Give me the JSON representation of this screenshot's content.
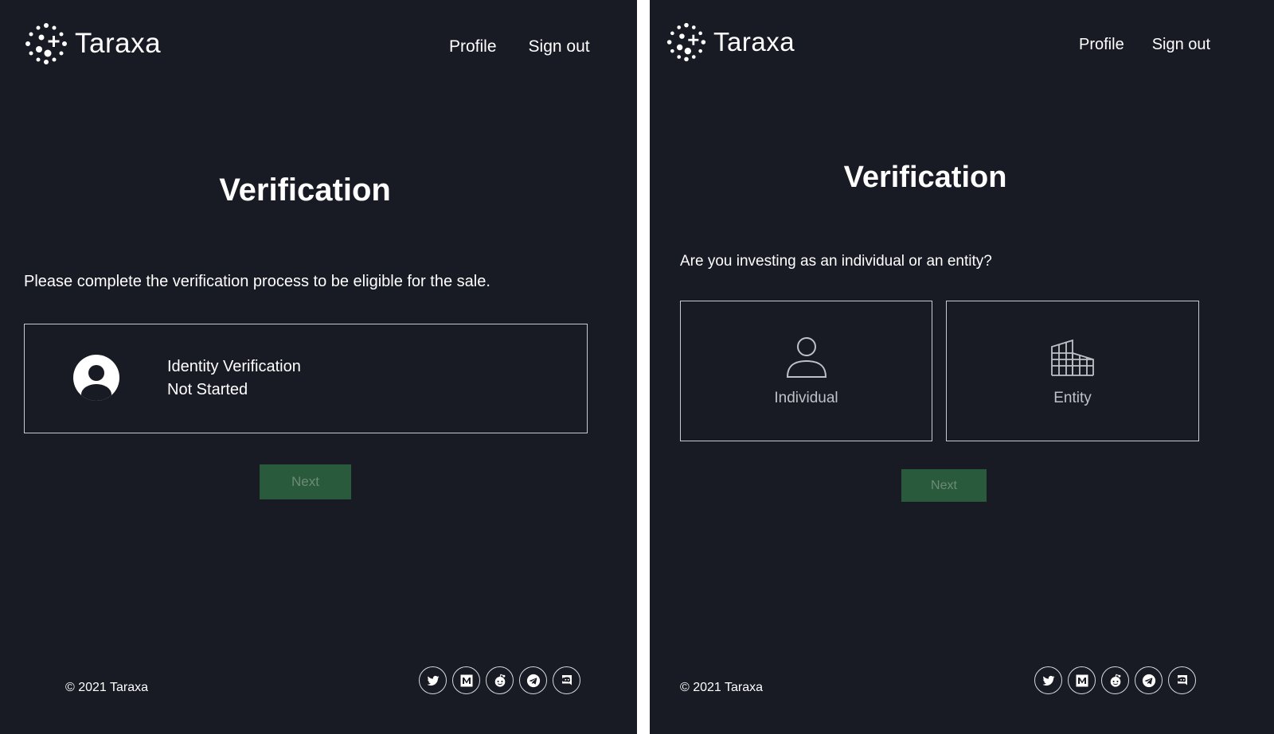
{
  "brand": {
    "name": "Taraxa"
  },
  "nav": {
    "profile": "Profile",
    "sign_out": "Sign out"
  },
  "left": {
    "title": "Verification",
    "description": "Please complete the verification process to be eligible for the sale.",
    "card": {
      "label": "Identity Verification",
      "status": "Not Started"
    },
    "next": "Next"
  },
  "right": {
    "title": "Verification",
    "question": "Are you investing as an individual or an entity?",
    "options": [
      {
        "label": "Individual",
        "icon": "person-outline-icon"
      },
      {
        "label": "Entity",
        "icon": "building-icon"
      }
    ],
    "next": "Next"
  },
  "footer": {
    "copyright": "© 2021 Taraxa",
    "social_icons": [
      "twitter-icon",
      "medium-icon",
      "reddit-icon",
      "telegram-icon",
      "discord-icon"
    ]
  },
  "colors": {
    "background": "#181a24",
    "text": "#ffffff",
    "button_bg": "#2a5a3c",
    "button_text": "#6d8a76",
    "border": "#c8cad0"
  }
}
